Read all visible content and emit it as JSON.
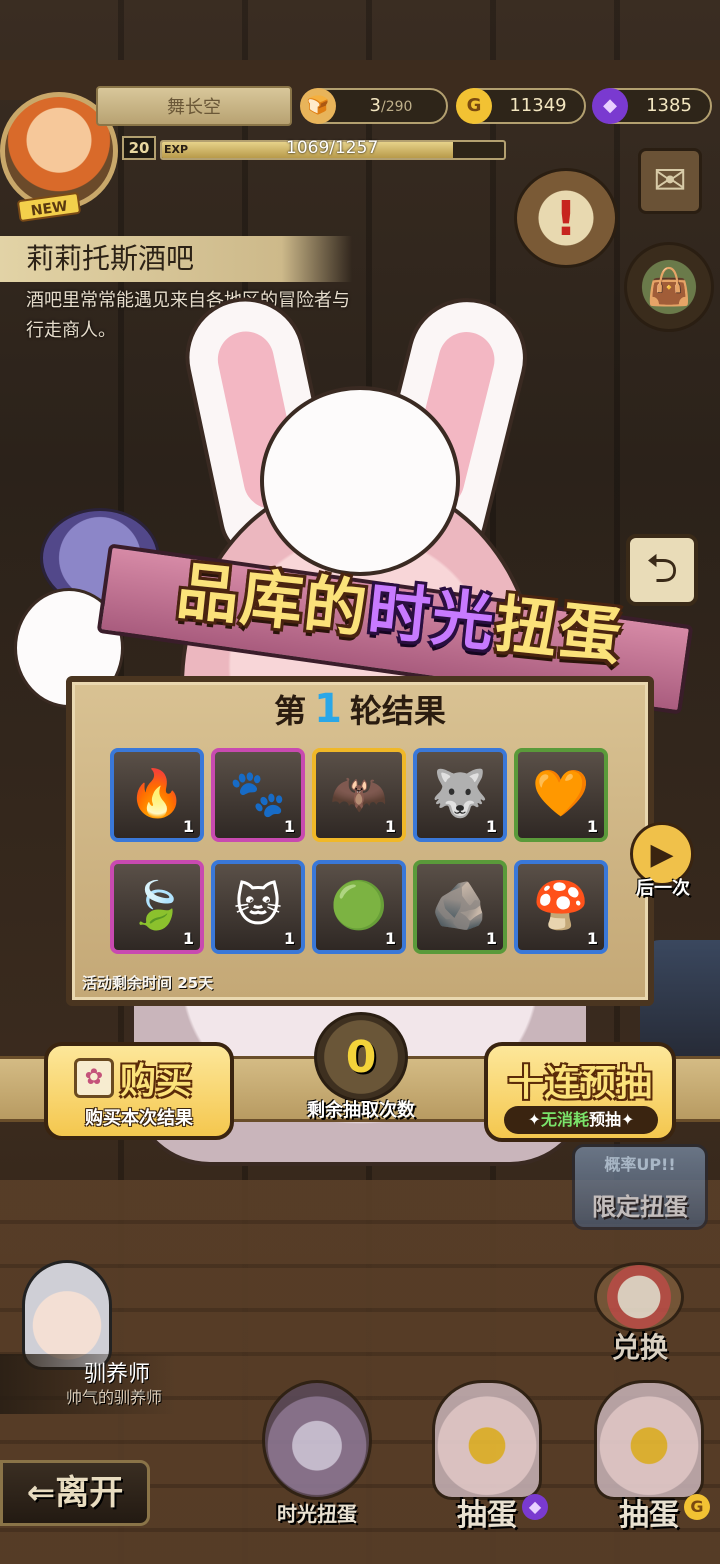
{
  "player": {
    "name": "舞长空",
    "level": "20",
    "exp_label": "EXP",
    "exp_text": "1069/1257",
    "exp_fraction": 0.85,
    "new_badge": "NEW"
  },
  "resources": {
    "bread_current": "3",
    "bread_max": "/290",
    "gold": "11349",
    "gems": "1385"
  },
  "location": {
    "title": "莉莉托斯酒吧",
    "description": "酒吧里常常能遇见来自各地区的冒险者与行走商人。"
  },
  "banner": {
    "title_pre": "品库的",
    "title_hl": "时光",
    "title_post": "扭蛋"
  },
  "results": {
    "round_prefix": "第",
    "round_number": "1",
    "round_suffix": "轮结果",
    "items": [
      {
        "icon": "flame-horn-item",
        "glyph": "🔥",
        "count": "1",
        "frame": "#3a78d8"
      },
      {
        "icon": "mummy-wrap-item",
        "glyph": "🐾",
        "count": "1",
        "frame": "#c84ab0"
      },
      {
        "icon": "dark-bat-wing-item",
        "glyph": "🦇",
        "count": "1",
        "frame": "#f0b828"
      },
      {
        "icon": "fire-fur-item",
        "glyph": "🐺",
        "count": "1",
        "frame": "#3a78d8"
      },
      {
        "icon": "orange-plush-item",
        "glyph": "🧡",
        "count": "1",
        "frame": "#5a9a3a"
      },
      {
        "icon": "leaf-bun-item",
        "glyph": "🍃",
        "count": "1",
        "frame": "#c84ab0"
      },
      {
        "icon": "cat-ear-hood-item",
        "glyph": "🐱",
        "count": "1",
        "frame": "#3a78d8"
      },
      {
        "icon": "green-slime-armor-item",
        "glyph": "🟢",
        "count": "1",
        "frame": "#3a78d8"
      },
      {
        "icon": "stone-helmet-item",
        "glyph": "🪨",
        "count": "1",
        "frame": "#5a9a3a"
      },
      {
        "icon": "spotted-mushroom-item",
        "glyph": "🍄",
        "count": "1",
        "frame": "#3a78d8"
      }
    ],
    "remaining_time": "活动剩余时间  25天"
  },
  "nav": {
    "next_label": "后一次",
    "next_glyph": "▶",
    "back_glyph": "⮌"
  },
  "actions": {
    "buy_title": "购买",
    "buy_sub": "购买本次结果",
    "draws_left": "0",
    "draws_left_label": "剩余抽取次数",
    "ten_title": "十连预抽",
    "ten_sub_free": "无消耗",
    "ten_sub_rest": "预抽"
  },
  "side": {
    "limit_top": "概率UP!!",
    "limit_main": "限定扭蛋",
    "exchange": "兑换"
  },
  "trainer": {
    "name": "驯养师",
    "title": "帅气的驯养师"
  },
  "bottom": {
    "leave": "⇐离开",
    "time_gacha": "时光扭蛋",
    "gacha_gem": "抽蛋",
    "gacha_gold": "抽蛋"
  },
  "colors": {
    "accent_gold": "#f3d33a",
    "round_number": "#2aa7e8",
    "banner_highlight": "#c77aff"
  }
}
